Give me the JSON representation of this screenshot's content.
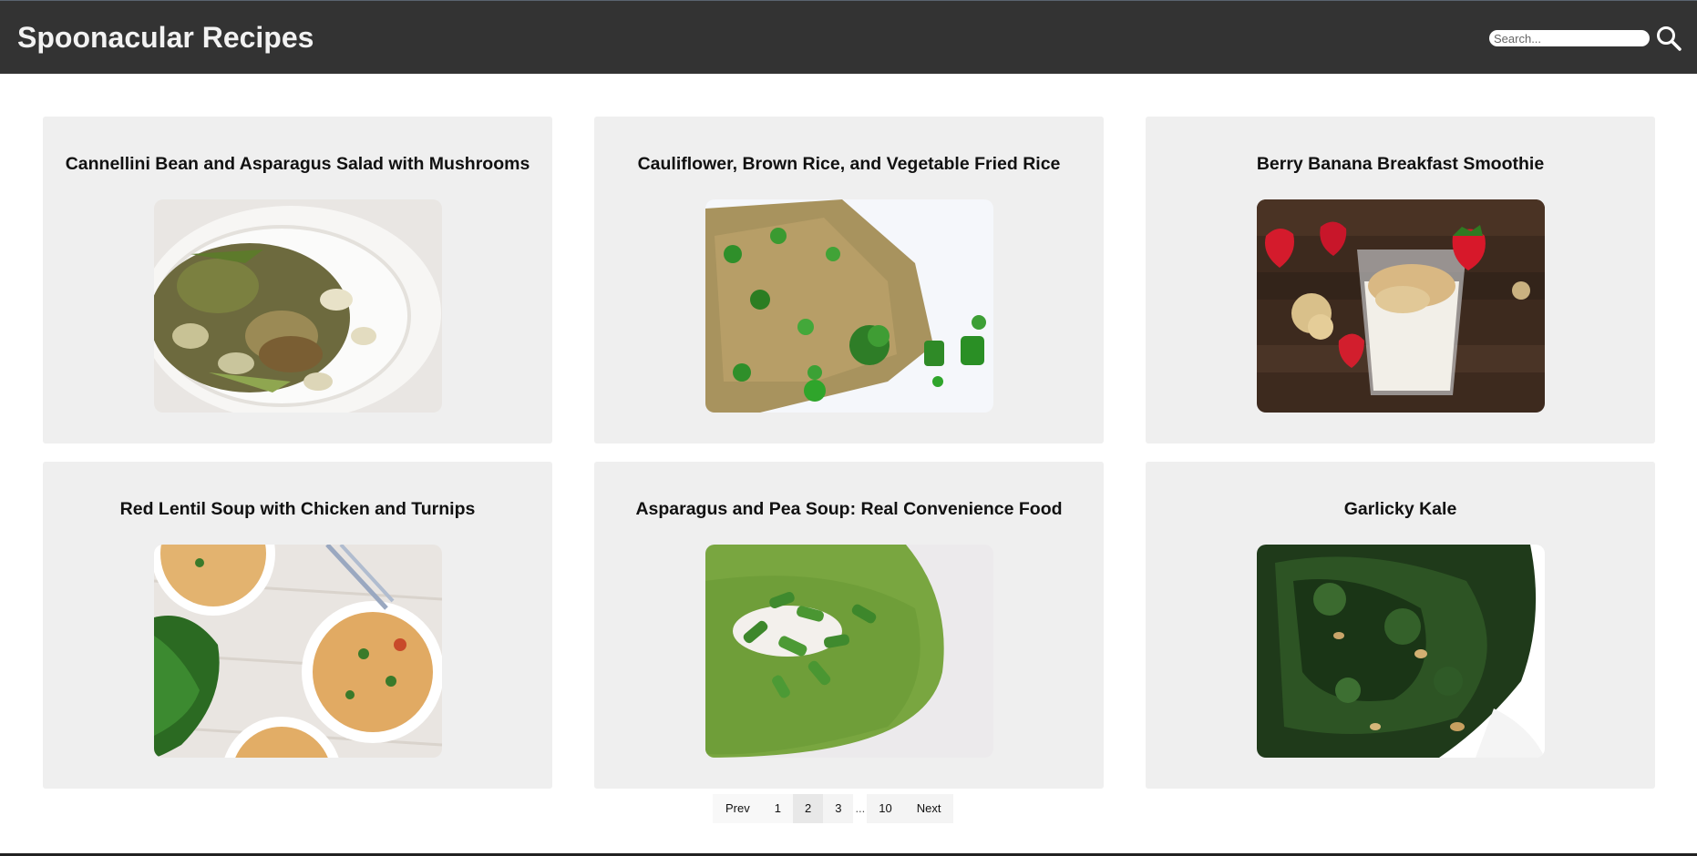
{
  "header": {
    "title": "Spoonacular Recipes",
    "search_placeholder": "Search...",
    "search_icon": "search-icon"
  },
  "recipes": [
    {
      "title": "Cannellini Bean and Asparagus Salad with Mushrooms"
    },
    {
      "title": "Cauliflower, Brown Rice, and Vegetable Fried Rice"
    },
    {
      "title": "Berry Banana Breakfast Smoothie"
    },
    {
      "title": "Red Lentil Soup with Chicken and Turnips"
    },
    {
      "title": "Asparagus and Pea Soup: Real Convenience Food"
    },
    {
      "title": "Garlicky Kale"
    }
  ],
  "pagination": {
    "prev": "Prev",
    "pages": [
      "1",
      "2",
      "3"
    ],
    "ellipsis": "...",
    "last": "10",
    "next": "Next",
    "current": "2"
  },
  "colors": {
    "header_bg": "#333333",
    "card_bg": "#efefef",
    "title_text": "#f2f2f2"
  }
}
